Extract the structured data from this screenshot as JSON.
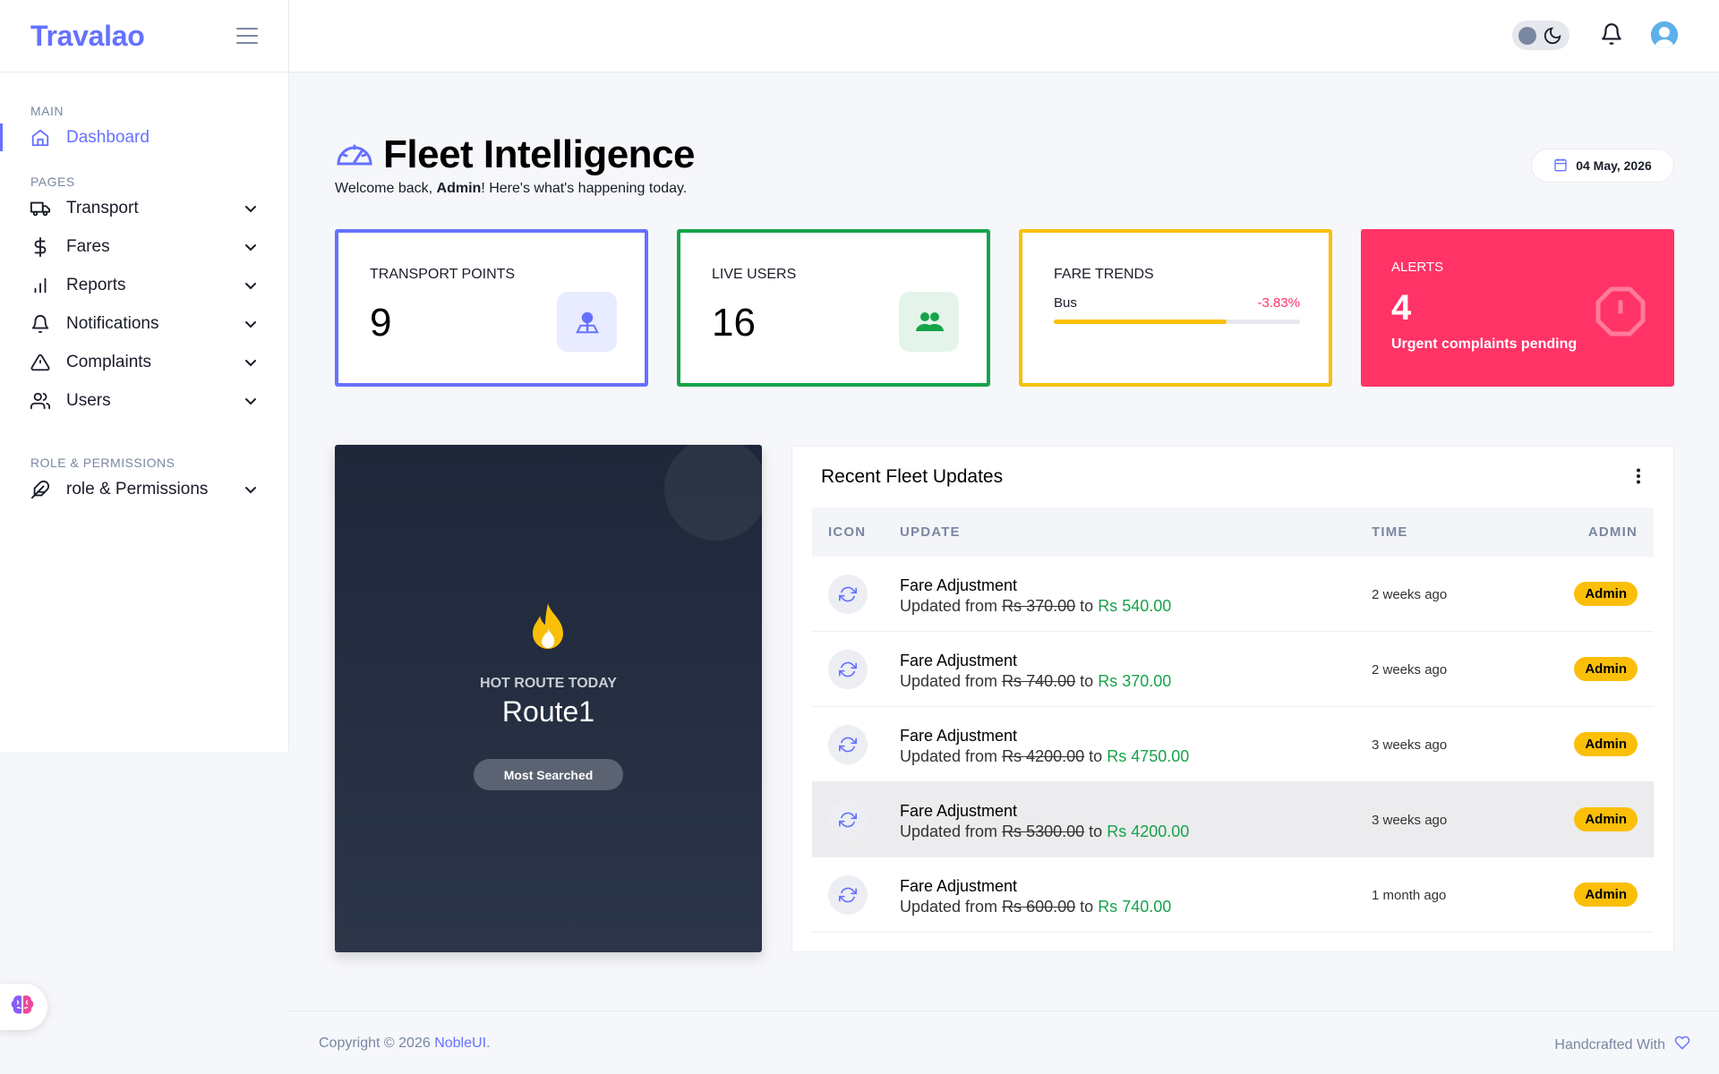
{
  "brand": "Travalao",
  "sidebar": {
    "section_main": "MAIN",
    "section_pages": "PAGES",
    "section_roles": "ROLE & PERMISSIONS",
    "items": [
      {
        "label": "Dashboard",
        "icon": "home-icon"
      },
      {
        "label": "Transport",
        "icon": "truck-icon"
      },
      {
        "label": "Fares",
        "icon": "dollar-icon"
      },
      {
        "label": "Reports",
        "icon": "bar-chart-icon"
      },
      {
        "label": "Notifications",
        "icon": "bell-icon"
      },
      {
        "label": "Complaints",
        "icon": "alert-triangle-icon"
      },
      {
        "label": "Users",
        "icon": "users-icon"
      },
      {
        "label": "role & Permissions",
        "icon": "feather-icon"
      }
    ]
  },
  "header": {
    "title": "Fleet Intelligence",
    "welcome_prefix": "Welcome back, ",
    "welcome_user": "Admin",
    "welcome_suffix": "! Here's what's happening today.",
    "date": "04 May, 2026"
  },
  "kpis": {
    "transport_points": {
      "label": "TRANSPORT POINTS",
      "value": "9"
    },
    "live_users": {
      "label": "LIVE USERS",
      "value": "16"
    },
    "fare_trends": {
      "label": "FARE TRENDS",
      "mode": "Bus",
      "change": "-3.83%",
      "progress": 0.7
    },
    "alerts": {
      "label": "ALERTS",
      "value": "4",
      "desc": "Urgent complaints pending"
    }
  },
  "hot_route": {
    "label": "HOT ROUTE TODAY",
    "route": "Route1",
    "button": "Most Searched"
  },
  "fleet_updates": {
    "title": "Recent Fleet Updates",
    "columns": [
      "ICON",
      "UPDATE",
      "TIME",
      "ADMIN"
    ],
    "rows": [
      {
        "title": "Fare Adjustment",
        "from_label": "Updated from",
        "old": "Rs 370.00",
        "to": "to",
        "new": "Rs 540.00",
        "time": "2 weeks ago",
        "admin": "Admin"
      },
      {
        "title": "Fare Adjustment",
        "from_label": "Updated from",
        "old": "Rs 740.00",
        "to": "to",
        "new": "Rs 370.00",
        "time": "2 weeks ago",
        "admin": "Admin"
      },
      {
        "title": "Fare Adjustment",
        "from_label": "Updated from",
        "old": "Rs 4200.00",
        "to": "to",
        "new": "Rs 4750.00",
        "time": "3 weeks ago",
        "admin": "Admin"
      },
      {
        "title": "Fare Adjustment",
        "from_label": "Updated from",
        "old": "Rs 5300.00",
        "to": "to",
        "new": "Rs 4200.00",
        "time": "3 weeks ago",
        "admin": "Admin"
      },
      {
        "title": "Fare Adjustment",
        "from_label": "Updated from",
        "old": "Rs 600.00",
        "to": "to",
        "new": "Rs 740.00",
        "time": "1 month ago",
        "admin": "Admin"
      }
    ]
  },
  "footer": {
    "copyright": "Copyright © 2026 ",
    "brand_link": "NobleUI",
    "period": ".",
    "handcrafted": "Handcrafted With"
  },
  "colors": {
    "primary": "#6571ff",
    "success": "#16a34a",
    "warning": "#fbbf0a",
    "danger": "#ff3366"
  }
}
